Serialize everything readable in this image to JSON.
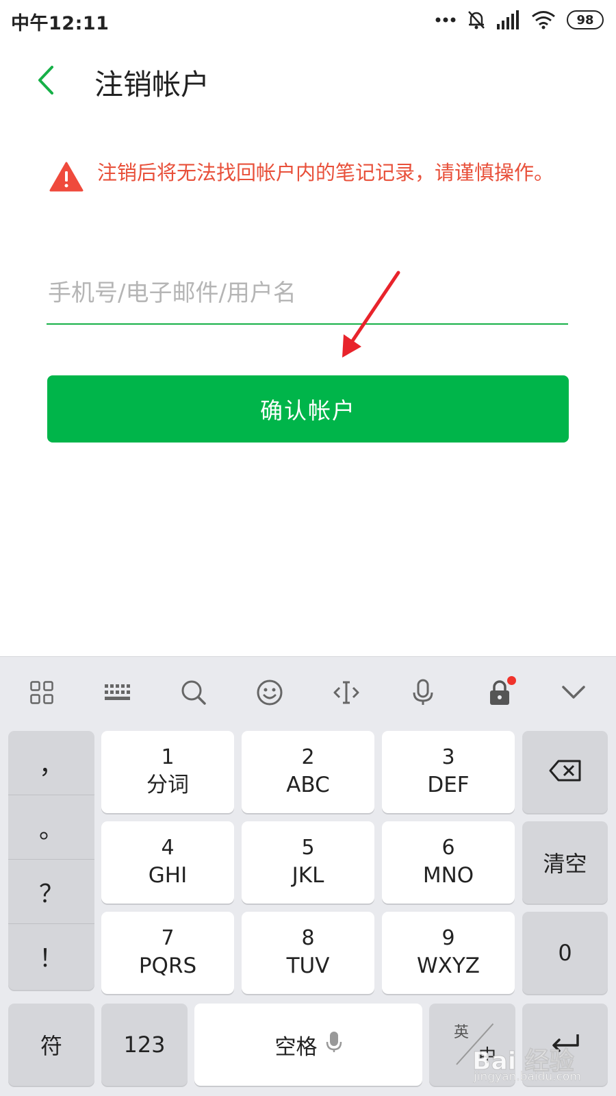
{
  "status_bar": {
    "time": "中午12:11",
    "battery": "98",
    "icons": [
      "more-dots-icon",
      "mute-bell-icon",
      "signal-icon",
      "wifi-icon",
      "battery-icon"
    ]
  },
  "header": {
    "title": "注销帐户",
    "back_icon": "chevron-left-icon"
  },
  "warning": {
    "icon": "warning-triangle-icon",
    "text": "注销后将无法找回帐户内的笔记记录，请谨慎操作。"
  },
  "account_input": {
    "value": "",
    "placeholder": "手机号/电子邮件/用户名"
  },
  "confirm_button": {
    "label": "确认帐户"
  },
  "colors": {
    "accent": "#00b54a",
    "warning": "#e8503a",
    "annotation": "#e8232b",
    "keyboard_bg": "#e9eaee"
  },
  "keyboard": {
    "toolbar": [
      "grid-apps-icon",
      "keyboard-icon",
      "search-icon",
      "emoji-icon",
      "cursor-move-icon",
      "microphone-icon",
      "lock-icon",
      "collapse-chevron-icon"
    ],
    "punctuation": [
      "，",
      "。",
      "？",
      "！"
    ],
    "keys": [
      {
        "num": "1",
        "letters": "分词"
      },
      {
        "num": "2",
        "letters": "ABC"
      },
      {
        "num": "3",
        "letters": "DEF"
      },
      {
        "num": "4",
        "letters": "GHI"
      },
      {
        "num": "5",
        "letters": "JKL"
      },
      {
        "num": "6",
        "letters": "MNO"
      },
      {
        "num": "7",
        "letters": "PQRS"
      },
      {
        "num": "8",
        "letters": "TUV"
      },
      {
        "num": "9",
        "letters": "WXYZ"
      }
    ],
    "backspace_icon": "backspace-icon",
    "clear_label": "清空",
    "zero_label": "0",
    "symbol_label": "符",
    "num_label": "123",
    "space_label": "空格",
    "space_icon": "microphone-icon",
    "lang_top": "英",
    "lang_bottom": "中",
    "enter_icon": "enter-icon"
  },
  "watermark": {
    "text": "Bai 经验",
    "sub": "jingyan.baidu.com"
  }
}
